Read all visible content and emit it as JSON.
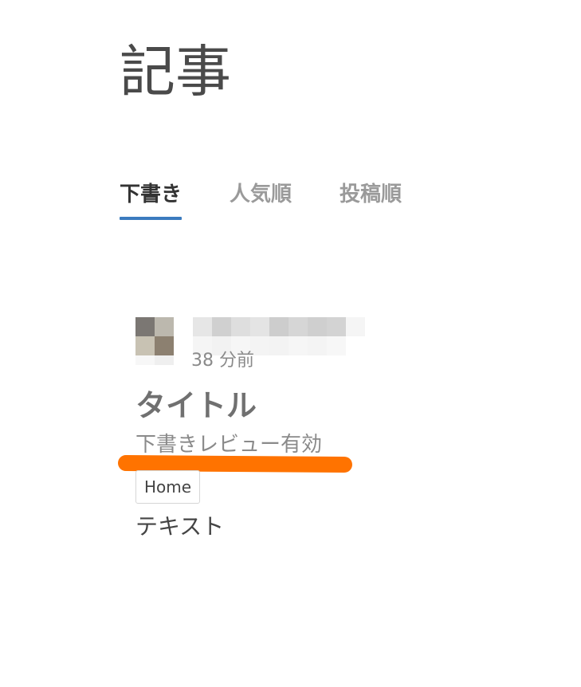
{
  "page": {
    "title": "記事"
  },
  "tabs": [
    {
      "label": "下書き",
      "active": true
    },
    {
      "label": "人気順",
      "active": false
    },
    {
      "label": "投稿順",
      "active": false
    }
  ],
  "post": {
    "timestamp": "38 分前",
    "title": "タイトル",
    "subtitle": "下書きレビュー有効",
    "tag": "Home",
    "body": "テキスト"
  },
  "colors": {
    "accent": "#3b7bbf",
    "highlight_mark": "#ff7300"
  }
}
